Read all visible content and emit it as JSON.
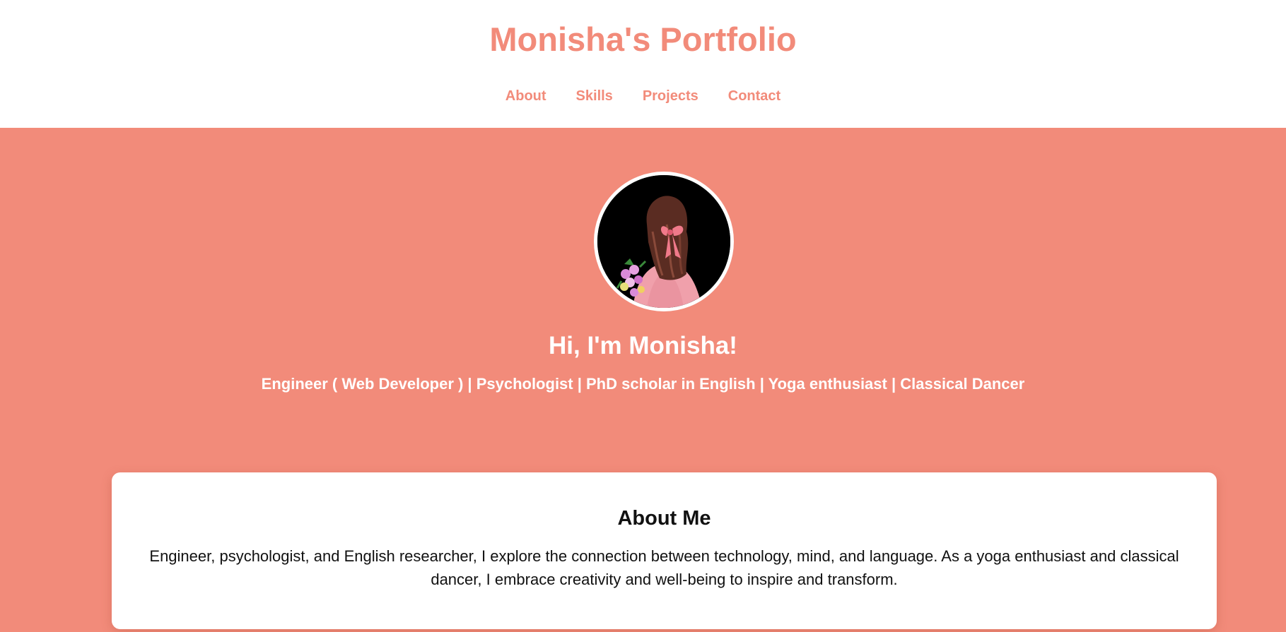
{
  "header": {
    "title": "Monisha's Portfolio",
    "nav": [
      {
        "label": "About"
      },
      {
        "label": "Skills"
      },
      {
        "label": "Projects"
      },
      {
        "label": "Contact"
      }
    ]
  },
  "hero": {
    "avatar_icon": "girl-with-bow-illustration",
    "title": "Hi, I'm Monisha!",
    "subtitle": "Engineer ( Web Developer ) | Psychologist | PhD scholar in English | Yoga enthusiast | Classical Dancer"
  },
  "about": {
    "title": "About Me",
    "text": "Engineer, psychologist, and English researcher, I explore the connection between technology, mind, and language. As a yoga enthusiast and classical dancer, I embrace creativity and well-being to inspire and transform."
  },
  "colors": {
    "accent": "#f28b7a",
    "header_bg": "#ffffff",
    "card_bg": "#ffffff",
    "text_dark": "#111111"
  }
}
